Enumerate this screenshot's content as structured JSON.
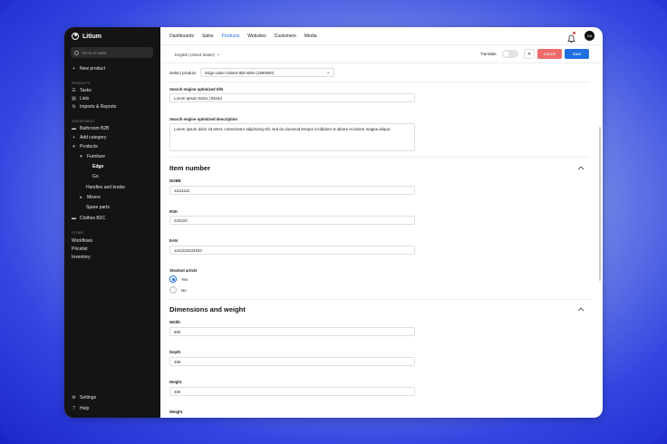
{
  "brand": {
    "name": "Litium"
  },
  "sidebar": {
    "search_placeholder": "Art no or name",
    "new_product": "New product",
    "sections": {
      "products": "PRODUCTS",
      "assortment": "ASSORTMENT",
      "other": "OTHER"
    },
    "product_items": [
      "Tasks",
      "Lists",
      "Imports & Reports"
    ],
    "tree": {
      "bathroom": "Bathroom B2B",
      "add_category": "Add category",
      "products": "Products",
      "furniture": "Furniture",
      "edge": "Edge",
      "go": "Go",
      "handles": "Handles and knobs",
      "mixers": "Mixers",
      "spare_parts": "Spare parts",
      "clothes": "Clothes B2C"
    },
    "other_items": [
      "Workflows",
      "Pricelist",
      "Inventory"
    ],
    "settings": "Settings",
    "help": "Help"
  },
  "topnav": {
    "tabs": [
      "Dashboards",
      "Sales",
      "Products",
      "Websites",
      "Customers",
      "Media"
    ],
    "active_tab": "Products",
    "avatar": "DA"
  },
  "toolbar": {
    "locale": "English (United States)",
    "translate": "Translate",
    "cancel": "Cancel",
    "save": "Save"
  },
  "form": {
    "select_product_label": "Select product",
    "select_product_value": "Edge under cabinet 600 white (1590000)",
    "seo_title_label": "Search engine optimized title",
    "seo_title_value": "Lorum Ipsum Dolor | Brand",
    "seo_desc_label": "Search engine optimized description",
    "seo_desc_value": "Lorem ipsum dolor sit amet, consectetur adipiscing elit, sed do eiusmod tempor incididunt ut labore et dolore magna aliqua.",
    "item_number_title": "Item number",
    "nobb_label": "NOBB",
    "nobb_value": "11111111",
    "rsk_label": "RSK",
    "rsk_value": "222222",
    "ean_label": "EAN",
    "ean_value": "1111222233333",
    "stocked_label": "Stocked article",
    "stocked_yes": "Yes",
    "stocked_no": "No",
    "stocked_selected": "Yes",
    "dimensions_title": "Dimensions and weight",
    "width_label": "Width",
    "width_value": "600",
    "depth_label": "Depth",
    "depth_value": "456",
    "height_label": "Height",
    "height_value": "450",
    "weight_label": "Weight"
  },
  "colors": {
    "accent": "#1f6fe0",
    "cancel": "#ee6b6b",
    "sidebar_bg": "#141414"
  }
}
